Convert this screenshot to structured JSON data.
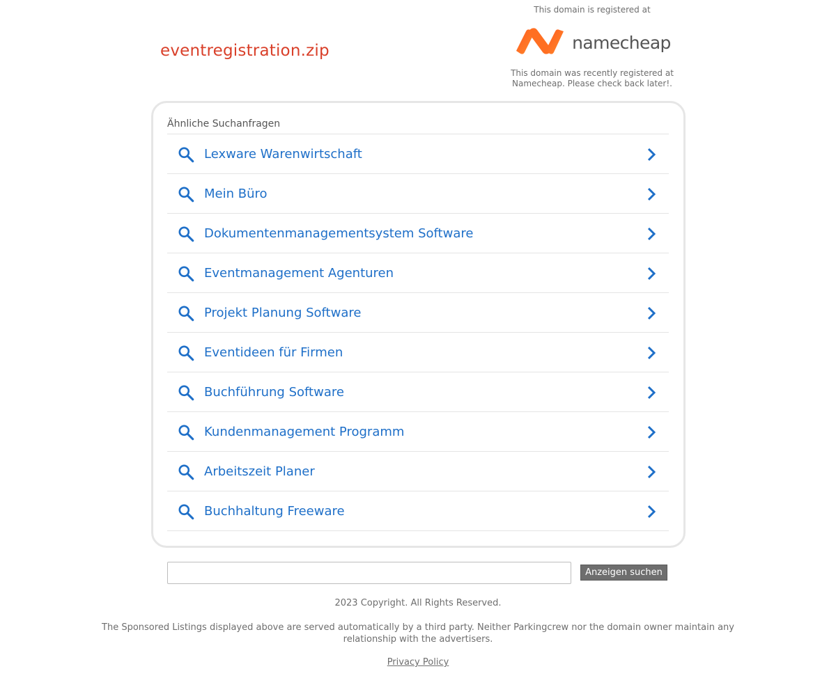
{
  "header": {
    "domain_name": "eventregistration.zip"
  },
  "registrar": {
    "top_note": "This domain is registered at",
    "logo_text": "namecheap",
    "bottom_note": "This domain was recently registered at Namecheap. Please check back later!."
  },
  "related": {
    "heading": "Ähnliche Suchanfragen",
    "items": [
      {
        "label": "Lexware Warenwirtschaft"
      },
      {
        "label": "Mein Büro"
      },
      {
        "label": "Dokumentenmanagementsystem Software"
      },
      {
        "label": "Eventmanagement Agenturen"
      },
      {
        "label": "Projekt Planung Software"
      },
      {
        "label": "Eventideen für Firmen"
      },
      {
        "label": "Buchführung Software"
      },
      {
        "label": "Kundenmanagement Programm"
      },
      {
        "label": "Arbeitszeit Planer"
      },
      {
        "label": "Buchhaltung Freeware"
      }
    ]
  },
  "search": {
    "value": "",
    "button_label": "Anzeigen suchen"
  },
  "footer": {
    "copyright": "2023 Copyright. All Rights Reserved.",
    "disclaimer": "The Sponsored Listings displayed above are served automatically by a third party. Neither Parkingcrew nor the domain owner maintain any relationship with the advertisers.",
    "privacy_label": "Privacy Policy"
  },
  "colors": {
    "domain_title": "#d9402a",
    "link_blue": "#1e6fc8",
    "logo_orange": "#f26522",
    "muted_text": "#6e6e6e"
  }
}
